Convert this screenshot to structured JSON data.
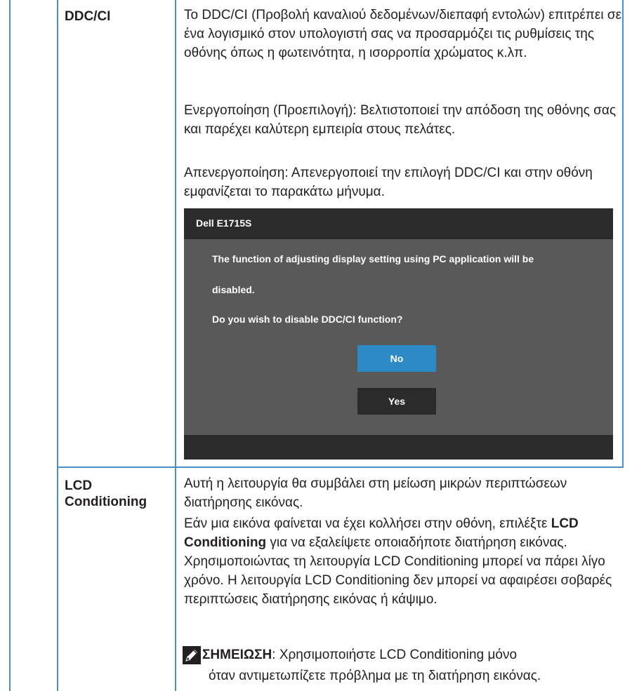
{
  "ddc_ci": {
    "label": "DDC/CI",
    "description": "Το DDC/CI (Προβολή καναλιού δεδομένων/διεπαφή εντολών) επιτρέπει σε ένα λογισμικό στον υπολογιστή σας να προσαρμόζει τις ρυθμίσεις της οθόνης όπως η φωτεινότητα, η ισορροπία χρώματος κ.λπ.",
    "enable_text": "Ενεργοποίηση (Προεπιλογή): Βελτιστοποιεί την απόδοση της οθόνης σας και παρέχει καλύτερη εμπειρία στους πελάτες.",
    "disable_text": "Απενεργοποίηση: Απενεργοποιεί την επιλογή DDC/CI και στην οθόνη εμφανίζεται το παρακάτω μήνυμα.",
    "osd": {
      "title": "Dell E1715S",
      "message_line1": "The function of adjusting display setting using PC application will be",
      "message_line2": "disabled.",
      "question": "Do you wish to disable DDC/CI function?",
      "no_label": "No",
      "yes_label": "Yes",
      "colors": {
        "title_bar": "#2b2b2b",
        "body": "#595959",
        "selected_button": "#2d8ac5"
      }
    }
  },
  "lcd_conditioning": {
    "label_line1": "LCD",
    "label_line2": "Conditioning",
    "para1": "Αυτή η λειτουργία θα συμβάλει στη μείωση μικρών περιπτώσεων διατήρησης εικόνας.",
    "para2_before": "Εάν μια εικόνα φαίνεται να έχει κολλήσει στην οθόνη, επιλέξτε ",
    "para2_bold": "LCD Conditioning",
    "para2_after": " για να εξαλείψετε οποιαδήποτε διατήρηση εικόνας. Χρησιμοποιώντας τη λειτουργία LCD Conditioning μπορεί να πάρει λίγο χρόνο. Η λειτουργία LCD Conditioning δεν μπορεί να αφαιρέσει σοβαρές περιπτώσεις διατήρησης εικόνας ή κάψιμο.",
    "note_label": "ΣΗΜΕΙΩΣΗ",
    "note_line1": ": Χρησιμοποιήστε LCD Conditioning μόνο",
    "note_line2": "όταν αντιμετωπίζετε πρόβλημα με τη διατήρηση εικόνας."
  },
  "colors": {
    "table_lines": "#4a8fc7",
    "text": "#231f20"
  },
  "icons": {
    "note": "pencil-note-icon"
  }
}
